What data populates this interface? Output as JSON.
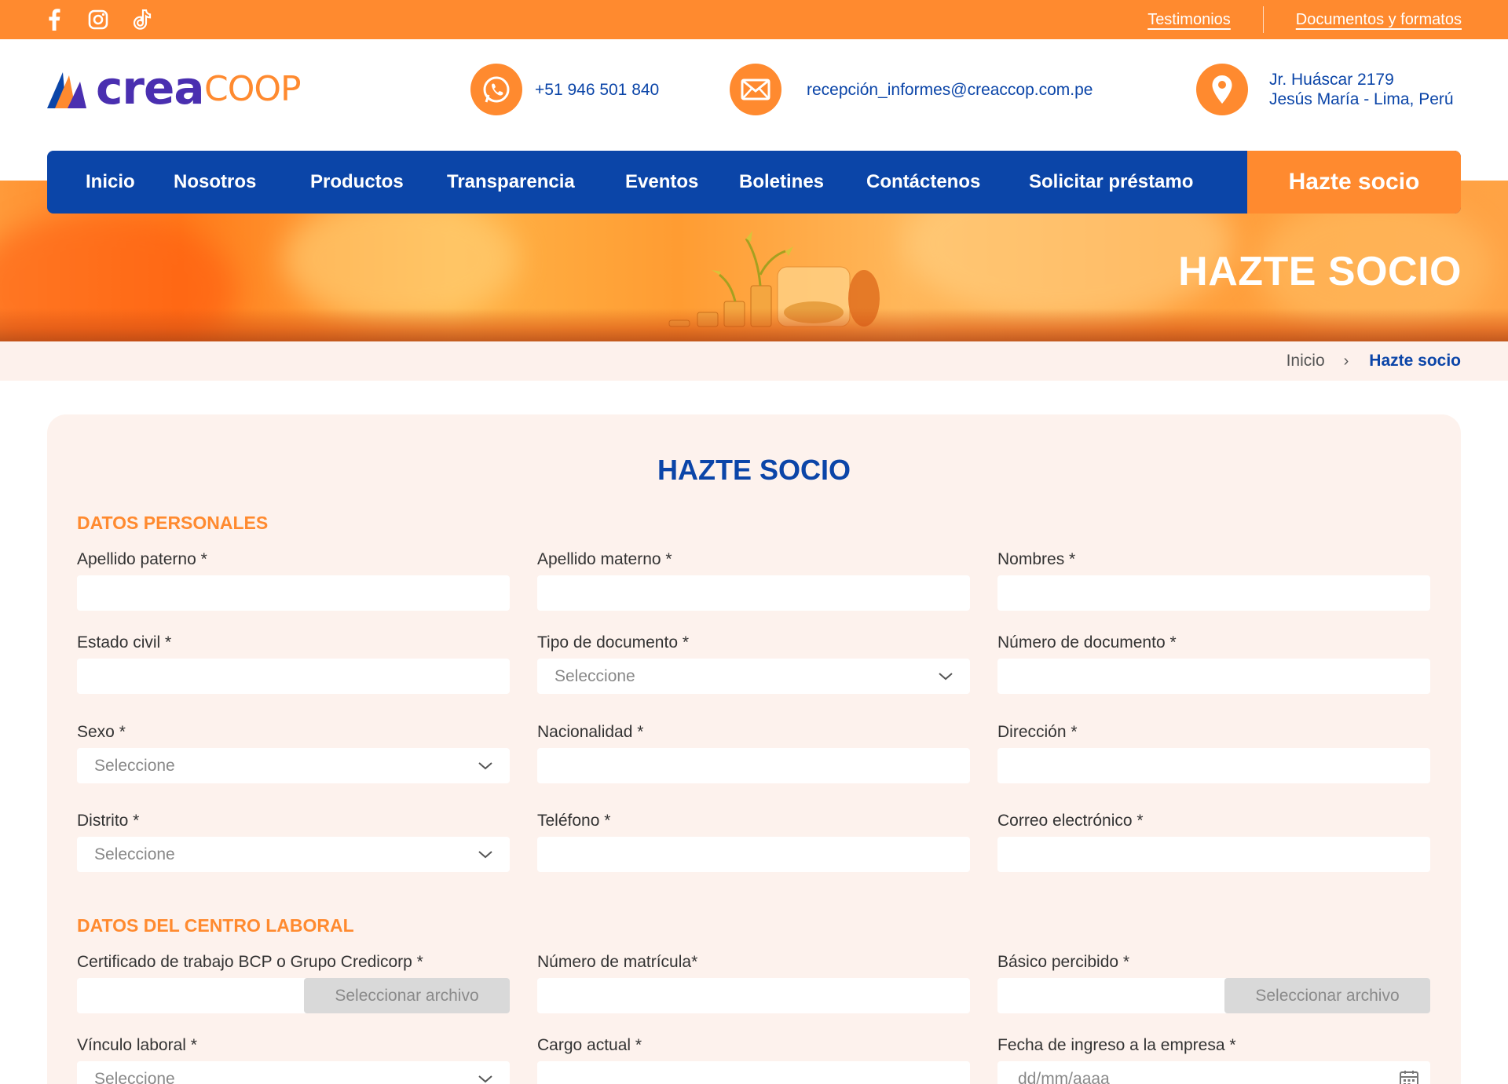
{
  "topbar": {
    "social": [
      "facebook-icon",
      "instagram-icon",
      "tiktok-icon"
    ],
    "links": [
      "Testimonios",
      "Documentos y formatos"
    ]
  },
  "header": {
    "logo": {
      "part1": "crea",
      "part2": "COOP"
    },
    "phone": "+51 946 501 840",
    "email": "recepción_informes@creaccop.com.pe",
    "address_line1": "Jr. Huáscar 2179",
    "address_line2": "Jesús María - Lima, Perú"
  },
  "nav": {
    "items": [
      "Inicio",
      "Nosotros",
      "Productos",
      "Transparencia",
      "Eventos",
      "Boletines",
      "Contáctenos",
      "Solicitar préstamo"
    ],
    "cta": "Hazte socio"
  },
  "hero": {
    "title": "HAZTE SOCIO"
  },
  "breadcrumb": {
    "home": "Inicio",
    "separator": "›",
    "current": "Hazte socio"
  },
  "form": {
    "title": "HAZTE SOCIO",
    "section_personal": "DATOS PERSONALES",
    "section_work": "DATOS DEL CENTRO LABORAL",
    "select_placeholder": "Seleccione",
    "file_button": "Seleccionar archivo",
    "date_placeholder": "dd/mm/aaaa",
    "labels": {
      "apellido_paterno": "Apellido paterno *",
      "apellido_materno": "Apellido materno *",
      "nombres": "Nombres *",
      "estado_civil": "Estado civil *",
      "tipo_documento": "Tipo de documento *",
      "numero_documento": "Número de documento *",
      "sexo": "Sexo *",
      "nacionalidad": "Nacionalidad *",
      "direccion": "Dirección *",
      "distrito": "Distrito *",
      "telefono": "Teléfono *",
      "correo": "Correo electrónico *",
      "certificado": "Certificado de trabajo BCP o Grupo Credicorp *",
      "matricula": "Número de matrícula*",
      "basico": "Básico percibido *",
      "vinculo": "Vínculo laboral *",
      "cargo": "Cargo actual *",
      "fecha_ingreso": "Fecha de ingreso a la empresa *"
    }
  },
  "colors": {
    "orange": "#ff8a2f",
    "blue": "#0b45a8",
    "card_bg": "#fdf2ed"
  }
}
